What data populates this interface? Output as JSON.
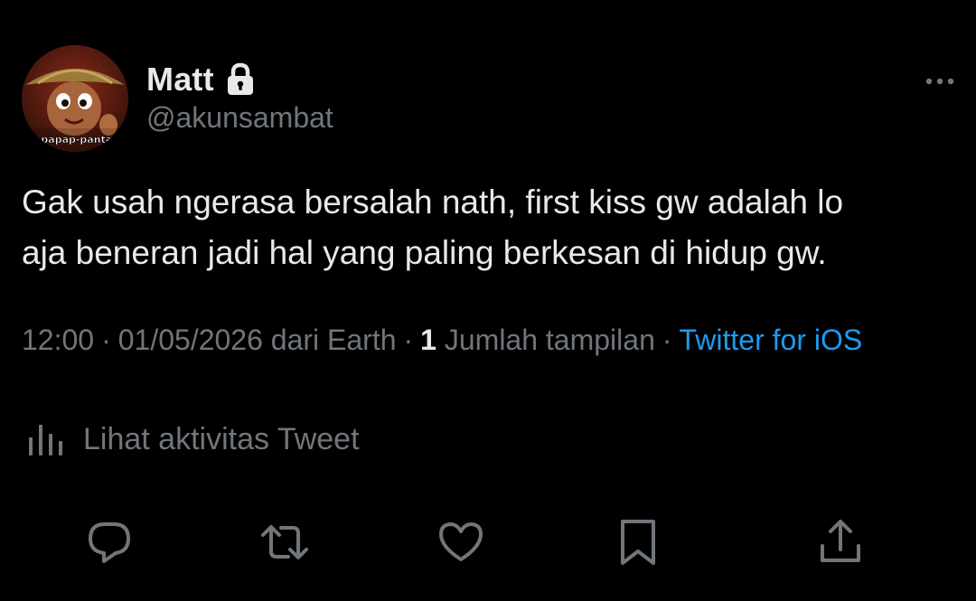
{
  "user": {
    "display_name": "Matt",
    "username": "@akunsambat",
    "avatar_caption": "apapap-pantai",
    "protected_icon": "lock-icon"
  },
  "tweet": {
    "text": "Gak usah ngerasa bersalah nath, first kiss gw adalah lo\naja beneran jadi hal yang paling berkesan di hidup gw."
  },
  "meta": {
    "time": "12:00",
    "date": "01/05/2026",
    "location": "dari Earth",
    "views_count": "1",
    "views_label": "Jumlah tampilan",
    "source": "Twitter for iOS",
    "separator": "·"
  },
  "activity": {
    "label": "Lihat aktivitas Tweet",
    "icon": "bar-chart-icon"
  },
  "actions": {
    "reply_icon": "reply-icon",
    "retweet_icon": "retweet-icon",
    "like_icon": "heart-icon",
    "bookmark_icon": "bookmark-icon",
    "share_icon": "share-icon"
  },
  "colors": {
    "background": "#000000",
    "primary_text": "#e7e9ea",
    "secondary_text": "#71767b",
    "link": "#1d9bf0"
  }
}
